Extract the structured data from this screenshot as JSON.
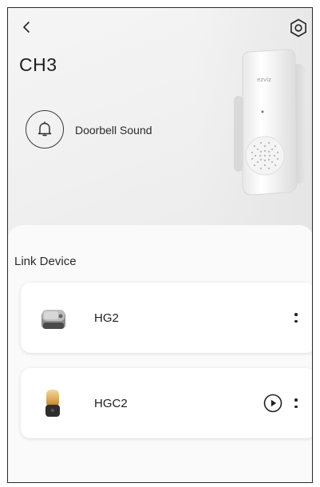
{
  "header": {
    "title": "CH3",
    "back_icon": "chevron-left-icon",
    "settings_icon": "gear-icon"
  },
  "doorbell": {
    "label": "Doorbell Sound",
    "icon": "bell-icon"
  },
  "product": {
    "brand": "ezviz"
  },
  "link_device": {
    "title": "Link Device",
    "devices": [
      {
        "name": "HG2",
        "icon": "camera-device-icon",
        "has_play": false,
        "more_icon": "more-vertical-icon"
      },
      {
        "name": "HGC2",
        "icon": "lamp-camera-device-icon",
        "has_play": true,
        "play_icon": "play-circle-icon",
        "more_icon": "more-vertical-icon"
      }
    ]
  },
  "colors": {
    "background": "#f3f3f3",
    "card": "#ffffff",
    "text": "#1e1e1e"
  }
}
